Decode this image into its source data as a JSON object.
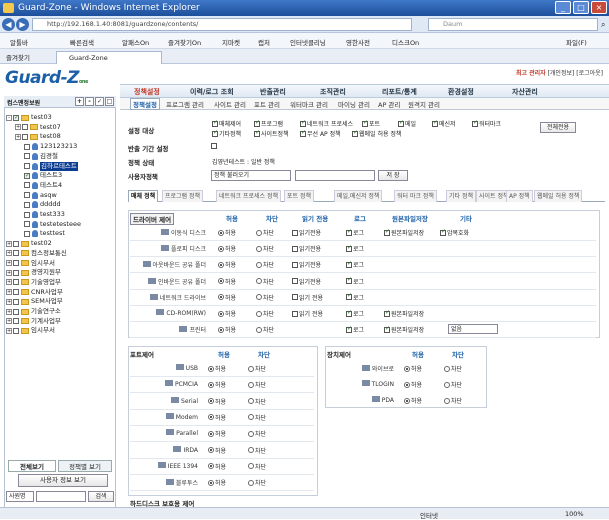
{
  "window": {
    "title": "Guard-Zone - Windows Internet Explorer",
    "min": "_",
    "max": "□",
    "close": "×"
  },
  "address": {
    "url": "http://192.168.1.40:8081/guardzone/contents/",
    "search_placeholder": "Daum"
  },
  "toolbar": {
    "items": [
      "알툴바",
      "빠른검색",
      "알패스On",
      "즐겨찾기On",
      "지마켓",
      "캡처",
      "인터넷클리닝",
      "영한사전",
      "디스크On"
    ],
    "right": "파일(F)"
  },
  "favbar": {
    "favorites": "즐겨찾기",
    "tab": "Guard-Zone"
  },
  "app": {
    "logo": "Guard-Z",
    "logo_sub": "one",
    "user": "최고 관리자",
    "user_links": "[개인정보] [로그아웃]"
  },
  "mainmenu": [
    "정책설정",
    "이력/로그 조회",
    "반출관리",
    "조직관리",
    "리포트/통계",
    "환경설정",
    "자산관리"
  ],
  "submenu": [
    "정책설정",
    "프로그램 관리",
    "사이트 관리",
    "포트 관리",
    "워터마크 관리",
    "마이닝 관리",
    "AP 관리",
    "원격지 관리"
  ],
  "leftpanel": {
    "title": "컴스맨정보원",
    "ctrl": [
      "+",
      "-",
      "✓",
      "□"
    ]
  },
  "tree": [
    {
      "indent": 0,
      "pm": "-",
      "cb": "chk",
      "icon": "fold",
      "label": "test03"
    },
    {
      "indent": 1,
      "pm": "+",
      "cb": "",
      "icon": "fold",
      "label": "test07"
    },
    {
      "indent": 1,
      "pm": "+",
      "cb": "",
      "icon": "fold",
      "label": "test08"
    },
    {
      "indent": 2,
      "pm": "",
      "cb": "",
      "icon": "person",
      "label": "123123213"
    },
    {
      "indent": 2,
      "pm": "",
      "cb": "",
      "icon": "person",
      "label": "김경철"
    },
    {
      "indent": 2,
      "pm": "",
      "cb": "",
      "icon": "person",
      "label": "김하르테스트",
      "sel": true
    },
    {
      "indent": 2,
      "pm": "",
      "cb": "chk",
      "icon": "person",
      "label": "테스트3"
    },
    {
      "indent": 2,
      "pm": "",
      "cb": "",
      "icon": "person",
      "label": "테스트4"
    },
    {
      "indent": 2,
      "pm": "",
      "cb": "",
      "icon": "person",
      "label": "asqw"
    },
    {
      "indent": 2,
      "pm": "",
      "cb": "",
      "icon": "person",
      "label": "ddddd"
    },
    {
      "indent": 2,
      "pm": "",
      "cb": "",
      "icon": "person",
      "label": "test333"
    },
    {
      "indent": 2,
      "pm": "",
      "cb": "",
      "icon": "person",
      "label": "testetesteee"
    },
    {
      "indent": 2,
      "pm": "",
      "cb": "",
      "icon": "person",
      "label": "testtest"
    },
    {
      "indent": 0,
      "pm": "+",
      "cb": "",
      "icon": "fold",
      "label": "test02"
    },
    {
      "indent": 0,
      "pm": "+",
      "cb": "",
      "icon": "fold",
      "label": "컴스정보통신"
    },
    {
      "indent": 0,
      "pm": "+",
      "cb": "",
      "icon": "fold",
      "label": "임시부서"
    },
    {
      "indent": 0,
      "pm": "+",
      "cb": "",
      "icon": "fold",
      "label": "경영지원부"
    },
    {
      "indent": 0,
      "pm": "+",
      "cb": "",
      "icon": "fold",
      "label": "기술영업부"
    },
    {
      "indent": 0,
      "pm": "+",
      "cb": "",
      "icon": "fold",
      "label": "CNR사업부"
    },
    {
      "indent": 0,
      "pm": "+",
      "cb": "",
      "icon": "fold",
      "label": "SEM사업부"
    },
    {
      "indent": 0,
      "pm": "+",
      "cb": "",
      "icon": "fold",
      "label": "기술연구소"
    },
    {
      "indent": 0,
      "pm": "+",
      "cb": "",
      "icon": "fold",
      "label": "기계사업부"
    },
    {
      "indent": 0,
      "pm": "+",
      "cb": "",
      "icon": "fold",
      "label": "임시부서"
    }
  ],
  "lefttabs": [
    "전체보기",
    "정책별 보기"
  ],
  "userinfo_btn": "사용자 정보 보기",
  "leftsearch": {
    "select": "사원명",
    "btn": "검색"
  },
  "settings": {
    "target_label": "설정 대상",
    "targets": [
      {
        "label": "매체제어",
        "on": true
      },
      {
        "label": "프로그램",
        "on": true
      },
      {
        "label": "네트워크 프로세스",
        "on": true
      },
      {
        "label": "포트",
        "on": true
      },
      {
        "label": "메일",
        "on": true
      },
      {
        "label": "메신저",
        "on": true
      },
      {
        "label": "워터마크",
        "on": true
      },
      {
        "label": "기타정책",
        "on": true
      },
      {
        "label": "사이트정책",
        "on": true
      },
      {
        "label": "무선 AP 정책",
        "on": true
      },
      {
        "label": "웹메일 허용 정책",
        "on": true
      }
    ],
    "apply_all": "전체전용",
    "period_label": "반출 기간 설정",
    "status_label": "정책 상태",
    "status_value": "김영년테스트 : 일반 정책",
    "user_policy_label": "사용자정책",
    "user_policy_select": "정책 불러오기",
    "save": "저 장"
  },
  "subtabs": [
    "매체 정책",
    "프로그램 정책",
    "네트워크 프로세스 정책",
    "포트 정책",
    "메일,메신저 정책",
    "워터 마크 정책",
    "기타 정책",
    "사이트 정책",
    "AP 정책",
    "웹메일 허용 정책"
  ],
  "media": {
    "header_title": "드라이버 제어",
    "cols": [
      "허용",
      "차단",
      "읽기 전용",
      "로그",
      "원본파일저장",
      "기타"
    ],
    "rows": [
      {
        "name": "이동식 디스크",
        "allow": true,
        "block": false,
        "ro": "읽기전용",
        "log": true,
        "orig": true,
        "etc": "암복호화"
      },
      {
        "name": "플로피 디스크",
        "allow": true,
        "block": false,
        "ro": "읽기전용",
        "log": true,
        "orig": false,
        "etc": ""
      },
      {
        "name": "아웃바운드 공유 폴더",
        "allow": true,
        "block": false,
        "ro": "읽기전용",
        "log": true,
        "orig": false,
        "etc": ""
      },
      {
        "name": "인바운드 공유 폴더",
        "allow": true,
        "block": false,
        "ro": "읽기전용",
        "log": true,
        "orig": false,
        "etc": ""
      },
      {
        "name": "네트워크 드라이브",
        "allow": true,
        "block": false,
        "ro": "읽기 전용",
        "log": true,
        "orig": false,
        "etc": ""
      },
      {
        "name": "CD-ROM(RW)",
        "allow": true,
        "block": false,
        "ro": "읽기 전용",
        "log": true,
        "orig": true,
        "etc": ""
      },
      {
        "name": "프린터",
        "allow": true,
        "block": false,
        "ro": "",
        "log": true,
        "orig": true,
        "etc": "없음"
      }
    ]
  },
  "ports": {
    "header_title": "포트제어",
    "cols": [
      "허용",
      "차단"
    ],
    "rows": [
      {
        "name": "USB",
        "allow": true
      },
      {
        "name": "PCMCIA",
        "allow": true
      },
      {
        "name": "Serial",
        "allow": true
      },
      {
        "name": "Modem",
        "allow": true
      },
      {
        "name": "Parallel",
        "allow": true
      },
      {
        "name": "IRDA",
        "allow": true
      },
      {
        "name": "IEEE 1394",
        "allow": true
      },
      {
        "name": "블루투스",
        "allow": true
      }
    ]
  },
  "devices": {
    "header_title": "장치제어",
    "cols": [
      "허용",
      "차단"
    ],
    "rows": [
      {
        "name": "와이브로",
        "allow": true
      },
      {
        "name": "TLOGIN",
        "allow": true
      },
      {
        "name": "PDA",
        "allow": true
      }
    ]
  },
  "labels": {
    "allow": "허용",
    "block": "차단"
  },
  "bottom_header": "하드디스크 보호용 제어",
  "statusbar": {
    "zone": "인터넷",
    "zoom": "100%"
  }
}
